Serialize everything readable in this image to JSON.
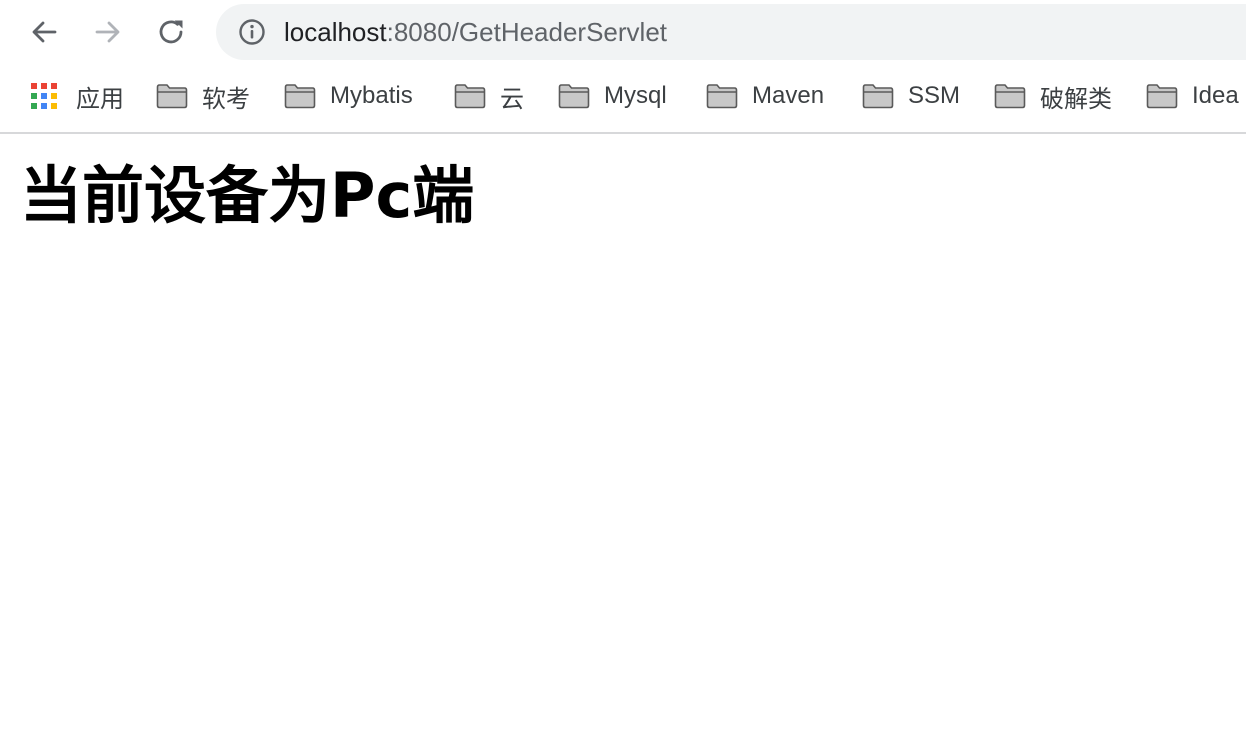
{
  "toolbar": {
    "back_icon": "arrow-left-icon",
    "forward_icon": "arrow-right-icon",
    "reload_icon": "reload-icon",
    "info_icon": "info-icon",
    "url_host": "localhost",
    "url_rest": ":8080/GetHeaderServlet",
    "forward_enabled": false
  },
  "bookmarks": {
    "items": [
      {
        "label": "应用",
        "icon": "apps-grid-icon"
      },
      {
        "label": "软考",
        "icon": "folder-icon"
      },
      {
        "label": "Mybatis",
        "icon": "folder-icon"
      },
      {
        "label": "云",
        "icon": "folder-icon"
      },
      {
        "label": "Mysql",
        "icon": "folder-icon"
      },
      {
        "label": "Maven",
        "icon": "folder-icon"
      },
      {
        "label": "SSM",
        "icon": "folder-icon"
      },
      {
        "label": "破解类",
        "icon": "folder-icon"
      },
      {
        "label": "Idea",
        "icon": "folder-icon"
      }
    ]
  },
  "page": {
    "heading": "当前设备为Pc端"
  },
  "colors": {
    "omnibox_bg": "#f1f3f4",
    "icon_gray": "#5f6368",
    "disabled_gray": "#b0b3b8"
  }
}
